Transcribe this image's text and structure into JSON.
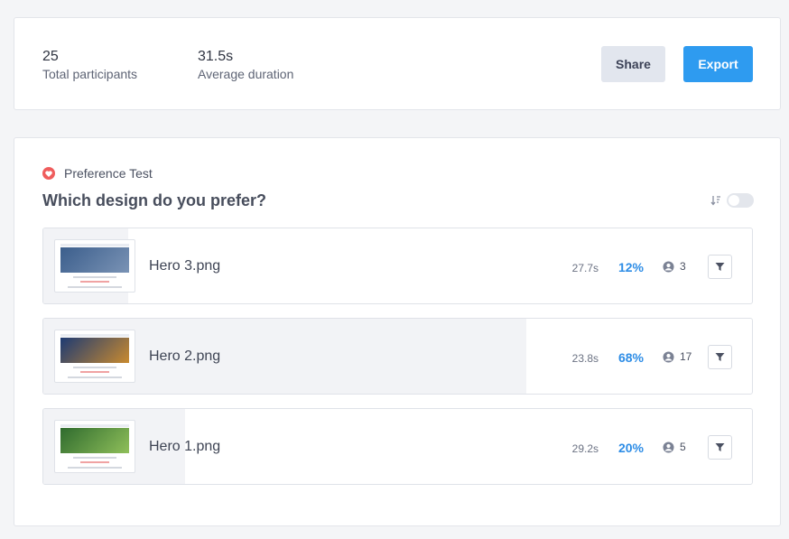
{
  "summary": {
    "participants": {
      "value": "25",
      "label": "Total participants"
    },
    "duration": {
      "value": "31.5s",
      "label": "Average duration"
    },
    "share_label": "Share",
    "export_label": "Export"
  },
  "test": {
    "type_label": "Preference Test",
    "type_icon": "heart-icon",
    "question": "Which design do you prefer?",
    "options": [
      {
        "name": "Hero 3.png",
        "time": "27.7s",
        "percent": "12%",
        "share": 0.12,
        "count": "3",
        "thumb_colors": [
          "#3b5e8c",
          "#7a93b5"
        ]
      },
      {
        "name": "Hero 2.png",
        "time": "23.8s",
        "percent": "68%",
        "share": 0.68,
        "count": "17",
        "thumb_colors": [
          "#1d3a73",
          "#c98a2f"
        ]
      },
      {
        "name": "Hero 1.png",
        "time": "29.2s",
        "percent": "20%",
        "share": 0.2,
        "count": "5",
        "thumb_colors": [
          "#2f6b2e",
          "#8fbf5a"
        ]
      }
    ]
  },
  "colors": {
    "accent": "#2e9bf0",
    "percent_text": "#2e8de6",
    "heart": "#ef5d5d"
  }
}
